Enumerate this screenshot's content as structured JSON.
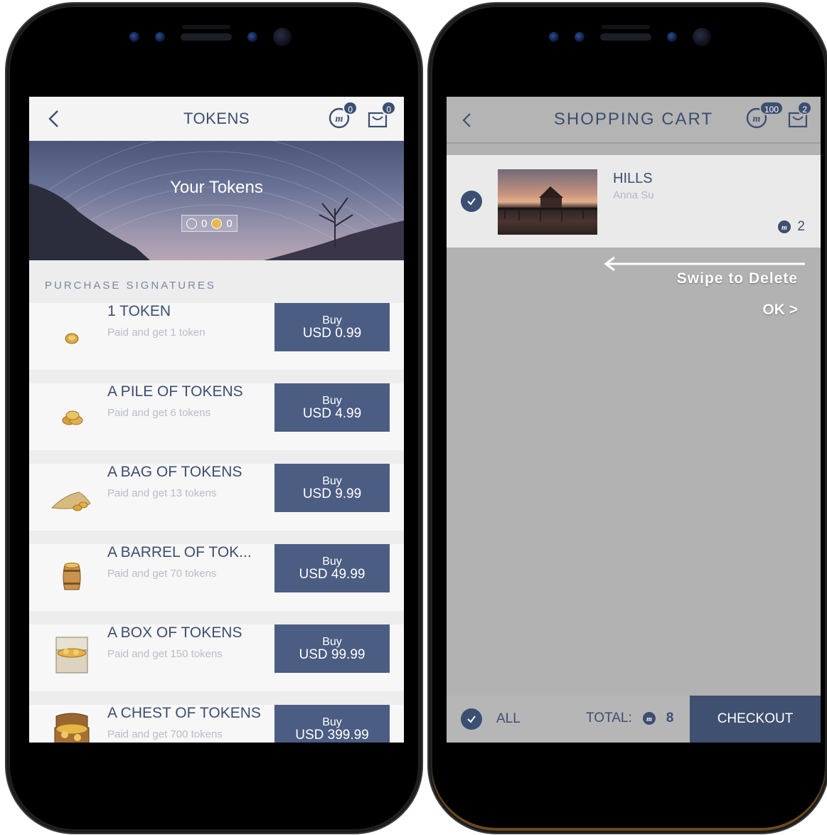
{
  "tokens_screen": {
    "title": "TOKENS",
    "m_badge": "0",
    "cart_badge": "0",
    "hero": {
      "title": "Your Tokens",
      "m_balance": "0",
      "coin_balance": "0"
    },
    "section_label": "PURCHASE SIGNATURES",
    "items": [
      {
        "name": "1 TOKEN",
        "desc": "Paid and get 1 token",
        "buy": "Buy",
        "price": "USD 0.99",
        "icon": "single-coin-icon"
      },
      {
        "name": "A PILE OF TOKENS",
        "desc": "Paid and get 6 tokens",
        "buy": "Buy",
        "price": "USD 4.99",
        "icon": "coin-pile-icon"
      },
      {
        "name": "A BAG OF TOKENS",
        "desc": "Paid and get 13 tokens",
        "buy": "Buy",
        "price": "USD 9.99",
        "icon": "coin-bag-icon"
      },
      {
        "name": "A BARREL OF TOK...",
        "desc": "Paid and get 70 tokens",
        "buy": "Buy",
        "price": "USD 49.99",
        "icon": "coin-barrel-icon"
      },
      {
        "name": "A BOX OF TOKENS",
        "desc": "Paid and get 150 tokens",
        "buy": "Buy",
        "price": "USD 99.99",
        "icon": "coin-box-icon"
      },
      {
        "name": "A CHEST OF TOKENS",
        "desc": "Paid and get 700 tokens",
        "buy": "Buy",
        "price": "USD 399.99",
        "icon": "treasure-chest-icon"
      }
    ]
  },
  "cart_screen": {
    "title": "SHOPPING CART",
    "m_badge": "100",
    "cart_badge": "2",
    "item": {
      "name": "HILLS",
      "artist": "Anna Su",
      "price": "2"
    },
    "swipe_hint": "Swipe to Delete",
    "ok_label": "OK >",
    "footer": {
      "all_label": "ALL",
      "total_label": "TOTAL:",
      "total_value": "8",
      "checkout_label": "CHECKOUT"
    }
  },
  "colors": {
    "navy": "#3d4e6e",
    "button": "#4b5d82",
    "badge": "#3b4f72"
  }
}
